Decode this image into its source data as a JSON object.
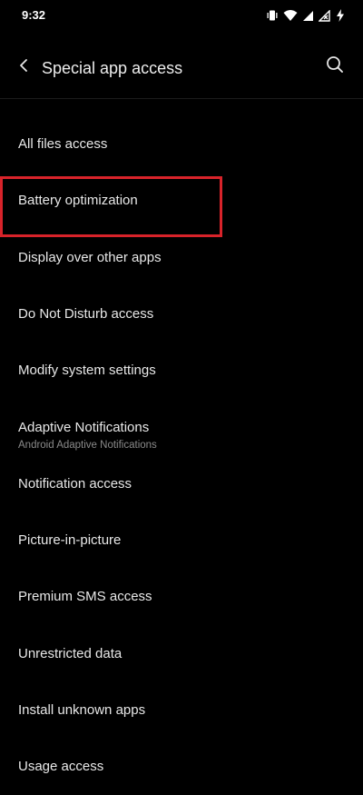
{
  "status_bar": {
    "time": "9:32",
    "icons": [
      "vibrate-icon",
      "wifi-icon",
      "signal-icon",
      "signal-no-data-icon",
      "charging-icon"
    ]
  },
  "app_bar": {
    "title": "Special app access",
    "back_icon": "back-arrow-icon",
    "search_icon": "search-icon"
  },
  "items": [
    {
      "title": "All files access"
    },
    {
      "title": "Battery optimization",
      "highlighted": true
    },
    {
      "title": "Display over other apps"
    },
    {
      "title": "Do Not Disturb access"
    },
    {
      "title": "Modify system settings"
    },
    {
      "title": "Adaptive Notifications",
      "subtitle": "Android Adaptive Notifications"
    },
    {
      "title": "Notification access"
    },
    {
      "title": "Picture-in-picture"
    },
    {
      "title": "Premium SMS access"
    },
    {
      "title": "Unrestricted data"
    },
    {
      "title": "Install unknown apps"
    },
    {
      "title": "Usage access"
    }
  ],
  "colors": {
    "background": "#000000",
    "highlight": "#d8232a",
    "text": "#e8e8e8",
    "subtext": "#8a8a8a"
  }
}
